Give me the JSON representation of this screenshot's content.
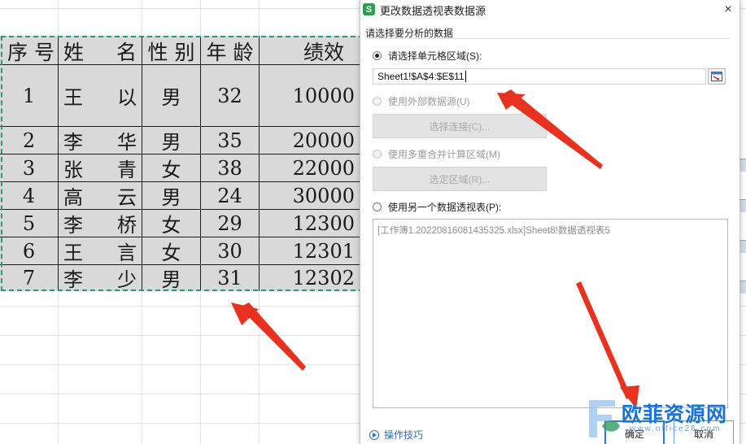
{
  "spreadsheet": {
    "headers": [
      "序 号",
      "姓",
      "名",
      "性 别",
      "年 龄",
      "绩效"
    ],
    "rows": [
      {
        "no": "1",
        "surname": "王",
        "given": "以",
        "gender": "男",
        "age": "32",
        "kpi": "10000"
      },
      {
        "no": "2",
        "surname": "李",
        "given": "华",
        "gender": "男",
        "age": "35",
        "kpi": "20000"
      },
      {
        "no": "3",
        "surname": "张",
        "given": "青",
        "gender": "女",
        "age": "38",
        "kpi": "22000"
      },
      {
        "no": "4",
        "surname": "高",
        "given": "云",
        "gender": "男",
        "age": "24",
        "kpi": "30000"
      },
      {
        "no": "5",
        "surname": "李",
        "given": "桥",
        "gender": "女",
        "age": "29",
        "kpi": "12300"
      },
      {
        "no": "6",
        "surname": "王",
        "given": "言",
        "gender": "女",
        "age": "30",
        "kpi": "12301"
      },
      {
        "no": "7",
        "surname": "李",
        "given": "少",
        "gender": "男",
        "age": "31",
        "kpi": "12302"
      }
    ]
  },
  "dialog": {
    "app_icon": "S",
    "title": "更改数据透视表数据源",
    "close_icon": "×",
    "section_label": "请选择要分析的数据",
    "opt_select_range": "请选择单元格区域(S):",
    "range_value": "Sheet1!$A$4:$E$11",
    "opt_external_source": "使用外部数据源(U)",
    "btn_choose_connection": "选择连接(C)...",
    "opt_multi_consolidation": "使用多重合并计算区域(M)",
    "btn_select_region": "选定区域(R)...",
    "opt_other_pivot": "使用另一个数据透视表(P):",
    "pivot_item": "[工作簿1.20220816081435325.xlsx]Sheet8!数据透视表5",
    "tips_link": "操作技巧",
    "ok_label": "确定",
    "cancel_label": "取消"
  },
  "watermark": {
    "text": "欧菲资源网",
    "url": "www.office26.com"
  },
  "colors": {
    "selection_marquee": "#1f9e6e",
    "table_fill": "#d9d9d9",
    "arrow": "#e8321f",
    "primary_button_border": "#2f78c9",
    "link": "#2f6fbf"
  }
}
